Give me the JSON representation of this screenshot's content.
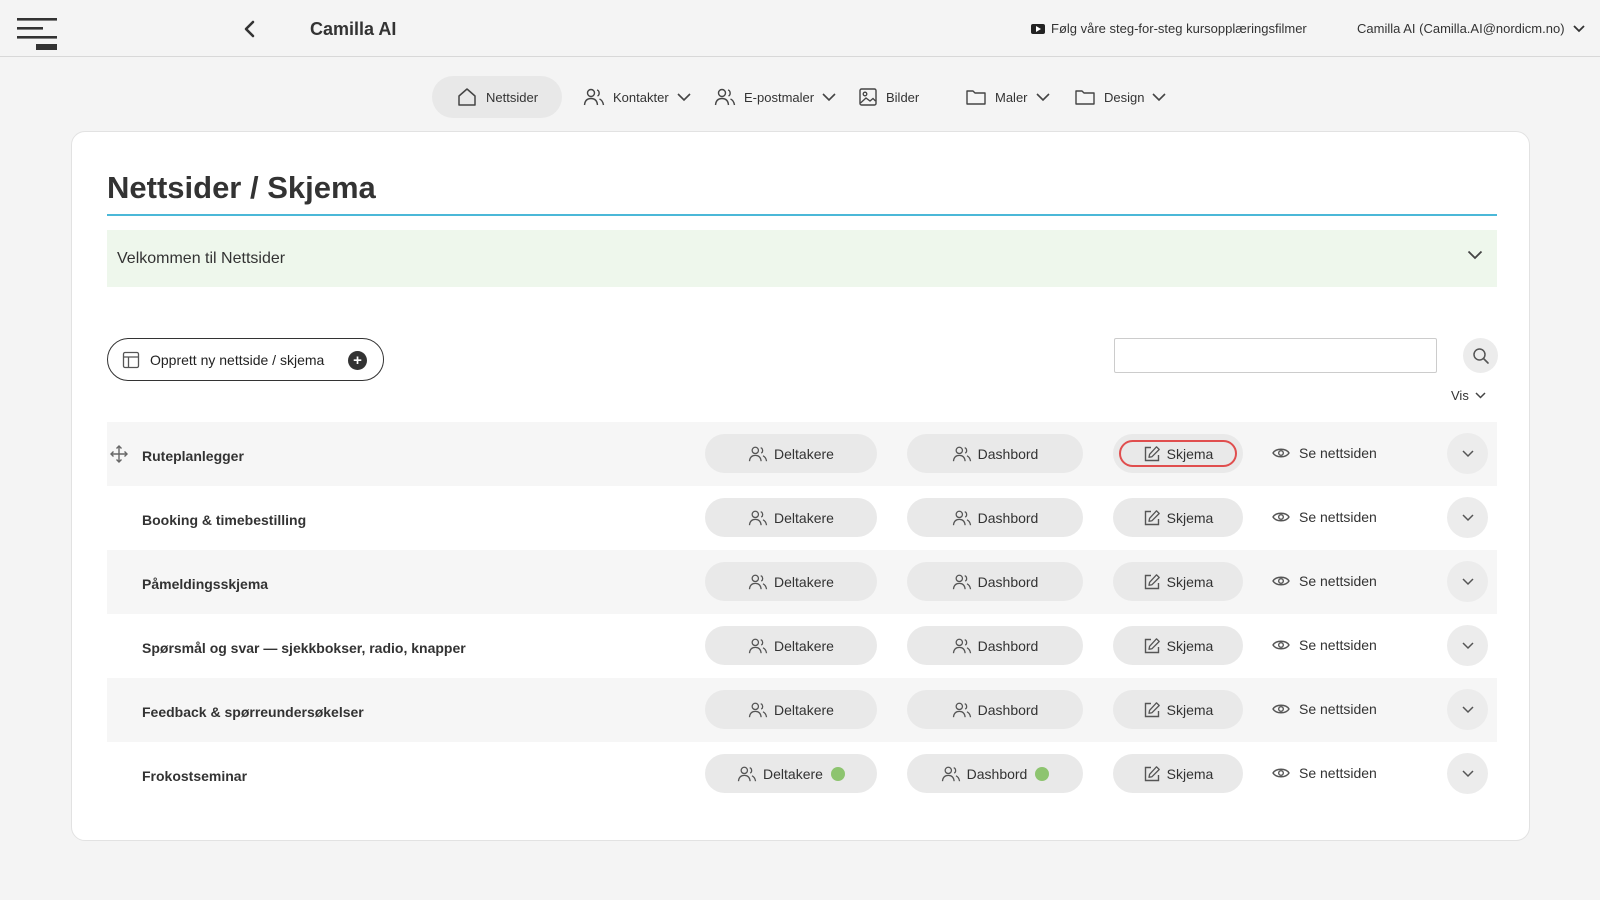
{
  "header": {
    "title": "Camilla AI",
    "video_link": "Følg våre steg-for-steg kursopplæringsfilmer",
    "user": "Camilla AI (Camilla.AI@nordicm.no)"
  },
  "nav": {
    "items": [
      {
        "label": "Nettsider",
        "icon": "home-icon",
        "active": true
      },
      {
        "label": "Kontakter",
        "icon": "people-icon",
        "dropdown": true
      },
      {
        "label": "E-postmaler",
        "icon": "people-icon",
        "dropdown": true
      },
      {
        "label": "Bilder",
        "icon": "image-icon"
      },
      {
        "label": "Maler",
        "icon": "folder-icon",
        "dropdown": true
      },
      {
        "label": "Design",
        "icon": "folder-icon",
        "dropdown": true
      }
    ]
  },
  "main": {
    "page_title": "Nettsider / Skjema",
    "welcome": "Velkommen til Nettsider",
    "create_button": "Opprett ny nettside / skjema",
    "search_placeholder": "",
    "vis_label": "Vis"
  },
  "row_actions": {
    "deltakere": "Deltakere",
    "dashbord": "Dashbord",
    "skjema": "Skjema",
    "se_nettsiden": "Se nettsiden"
  },
  "rows": [
    {
      "name": "Ruteplanlegger",
      "shaded": true,
      "drag": true,
      "status_dot": false
    },
    {
      "name": "Booking & timebestilling",
      "shaded": false,
      "drag": false,
      "status_dot": false
    },
    {
      "name": "Påmeldingsskjema",
      "shaded": true,
      "drag": false,
      "status_dot": false
    },
    {
      "name": "Spørsmål og svar — sjekkbokser, radio, knapper",
      "shaded": false,
      "drag": false,
      "status_dot": false
    },
    {
      "name": "Feedback & spørreundersøkelser",
      "shaded": true,
      "drag": false,
      "status_dot": false
    },
    {
      "name": "Frokostseminar",
      "shaded": false,
      "drag": false,
      "status_dot": true
    }
  ],
  "colors": {
    "accent_rule": "#4bb8d8",
    "welcome_bg": "#eef7ec",
    "status_dot": "#8dc46f",
    "highlight": "#e04e4e"
  }
}
